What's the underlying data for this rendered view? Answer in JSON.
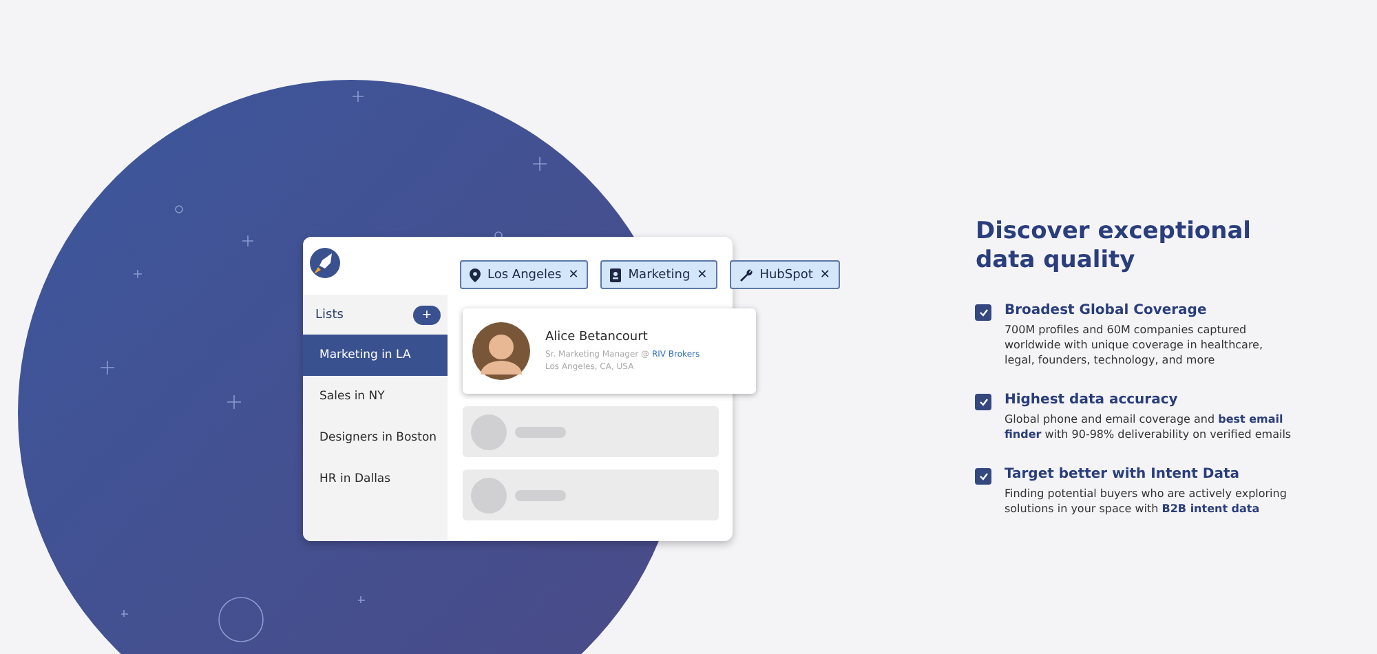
{
  "app_card": {
    "filters": [
      {
        "kind": "location",
        "label": "Los Angeles",
        "remove": "✕"
      },
      {
        "kind": "job",
        "label": "Marketing",
        "remove": "✕"
      },
      {
        "kind": "tool",
        "label": "HubSpot",
        "remove": "✕"
      }
    ],
    "lists_title": "Lists",
    "add_button": "+",
    "lists": [
      {
        "label": "Marketing in LA",
        "selected": true
      },
      {
        "label": "Sales in NY",
        "selected": false
      },
      {
        "label": "Designers in Boston",
        "selected": false
      },
      {
        "label": "HR in Dallas",
        "selected": false
      }
    ],
    "profile": {
      "name": "Alice Betancourt",
      "role": "Sr. Marketing Manager @",
      "company": "RIV Brokers",
      "location": "Los Angeles, CA, USA"
    }
  },
  "headline": "Discover exceptional data quality",
  "features": [
    {
      "checked": true,
      "title": "Broadest Global Coverage",
      "text": "700M profiles and 60M companies captured worldwide with unique coverage in healthcare, legal, founders, technology, and more"
    },
    {
      "checked": true,
      "title": "Highest data accuracy",
      "text": "Global phone and email coverage and **best email finder** with 90-98% deliverability on verified emails"
    },
    {
      "checked": true,
      "title": "Target better with Intent Data",
      "text": "Finding potential buyers who are actively exploring solutions in your space with **B2B intent data**"
    }
  ]
}
